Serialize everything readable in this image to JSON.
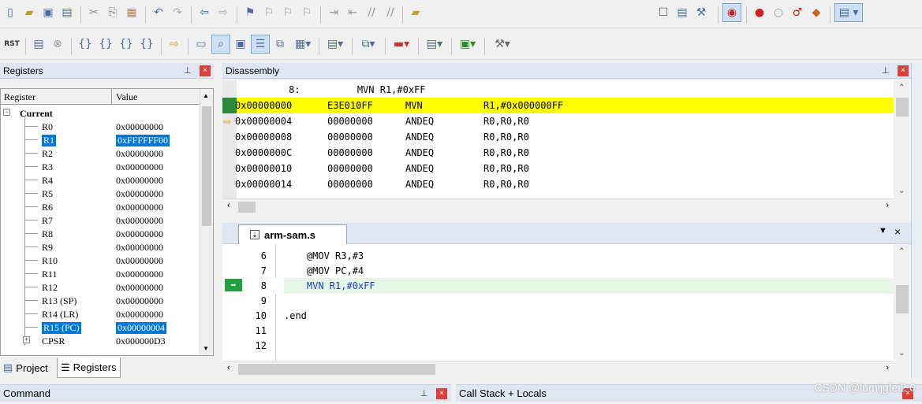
{
  "toolbar1": {
    "icons": [
      "new-file-icon",
      "open-folder-icon",
      "save-icon",
      "save-all-icon",
      "cut-icon",
      "copy-icon",
      "paste-icon",
      "undo-icon",
      "redo-icon",
      "back-icon",
      "forward-icon",
      "bookmark-icon",
      "prev-bookmark-icon",
      "next-bookmark-icon",
      "clear-bookmarks-icon",
      "indent-icon",
      "unindent-icon",
      "comment-icon",
      "uncomment-icon",
      "find-in-files-icon",
      "select-target-icon",
      "build-icon",
      "rebuild-icon",
      "debug-icon",
      "breakpoint-icon",
      "disable-breakpoint-icon",
      "kill-breakpoints-icon",
      "clear-breakpoints-icon",
      "window-layout-icon"
    ]
  },
  "toolbar2": {
    "rst_label": "RST",
    "icons": [
      "reset-icon",
      "run-icon",
      "stop-icon",
      "step-into-icon",
      "step-over-icon",
      "step-out-icon",
      "run-to-cursor-icon",
      "show-next-statement-icon",
      "command-window-icon",
      "disassembly-window-icon",
      "symbols-window-icon",
      "registers-window-icon",
      "call-stack-icon",
      "watch-window-icon",
      "memory-window-icon",
      "serial-window-icon",
      "analysis-window-icon",
      "trace-window-icon",
      "system-viewer-icon",
      "toolbox-icon"
    ]
  },
  "registers": {
    "title": "Registers",
    "col_register": "Register",
    "col_value": "Value",
    "group": "Current",
    "rows": [
      {
        "name": "R0",
        "value": "0x00000000"
      },
      {
        "name": "R1",
        "value": "0xFFFFFF00"
      },
      {
        "name": "R2",
        "value": "0x00000000"
      },
      {
        "name": "R3",
        "value": "0x00000000"
      },
      {
        "name": "R4",
        "value": "0x00000000"
      },
      {
        "name": "R5",
        "value": "0x00000000"
      },
      {
        "name": "R6",
        "value": "0x00000000"
      },
      {
        "name": "R7",
        "value": "0x00000000"
      },
      {
        "name": "R8",
        "value": "0x00000000"
      },
      {
        "name": "R9",
        "value": "0x00000000"
      },
      {
        "name": "R10",
        "value": "0x00000000"
      },
      {
        "name": "R11",
        "value": "0x00000000"
      },
      {
        "name": "R12",
        "value": "0x00000000"
      },
      {
        "name": "R13 (SP)",
        "value": "0x00000000"
      },
      {
        "name": "R14 (LR)",
        "value": "0x00000000"
      },
      {
        "name": "R15 (PC)",
        "value": "0x00000004"
      },
      {
        "name": "CPSR",
        "value": "0x000000D3"
      }
    ]
  },
  "bottom_tabs": {
    "project": "Project",
    "registers": "Registers"
  },
  "disassembly": {
    "title": "Disassembly",
    "source_line": "     8:          MVN R1,#0xFF",
    "lines": [
      {
        "addr": "0x00000000",
        "opcode": "E3E010FF",
        "mnemonic": "MVN",
        "operands": "R1,#0x000000FF"
      },
      {
        "addr": "0x00000004",
        "opcode": "00000000",
        "mnemonic": "ANDEQ",
        "operands": "R0,R0,R0"
      },
      {
        "addr": "0x00000008",
        "opcode": "00000000",
        "mnemonic": "ANDEQ",
        "operands": "R0,R0,R0"
      },
      {
        "addr": "0x0000000C",
        "opcode": "00000000",
        "mnemonic": "ANDEQ",
        "operands": "R0,R0,R0"
      },
      {
        "addr": "0x00000010",
        "opcode": "00000000",
        "mnemonic": "ANDEQ",
        "operands": "R0,R0,R0"
      },
      {
        "addr": "0x00000014",
        "opcode": "00000000",
        "mnemonic": "ANDEQ",
        "operands": "R0,R0,R0"
      }
    ]
  },
  "editor": {
    "tab": "arm-sam.s",
    "lines": [
      {
        "num": "6",
        "code": "    @MOV R3,#3"
      },
      {
        "num": "7",
        "code": "    @MOV PC,#4"
      },
      {
        "num": "8",
        "code": "    MVN R1,#0xFF"
      },
      {
        "num": "9",
        "code": ""
      },
      {
        "num": "10",
        "code": ".end"
      },
      {
        "num": "11",
        "code": ""
      },
      {
        "num": "12",
        "code": ""
      }
    ]
  },
  "command": {
    "title": "Command"
  },
  "callstack": {
    "title": "Call Stack + Locals"
  },
  "watermark": "CSDN @lumijgfei2 0",
  "colors": {
    "current_line": "#ffff00",
    "selection": "#0078d7",
    "exec_arrow": "#22a040",
    "pc_arrow": "#ffd700",
    "editor_highlight": "#e6f7e6"
  }
}
